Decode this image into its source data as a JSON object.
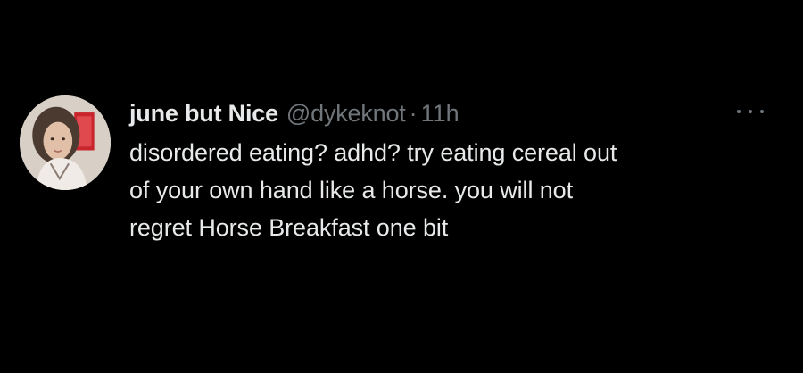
{
  "tweet": {
    "display_name": "june but Nice",
    "handle": "@dykeknot",
    "separator": "·",
    "time": "11h",
    "body_lines": [
      "disordered eating? adhd? try eating cereal out",
      "of your own hand like a horse. you will not",
      "regret Horse Breakfast one bit"
    ],
    "avatar_icon": "profile-photo",
    "more_icon": "more-options-icon"
  },
  "colors": {
    "background": "#000000",
    "primary_text": "#e7e9ea",
    "secondary_text": "#71767b"
  }
}
